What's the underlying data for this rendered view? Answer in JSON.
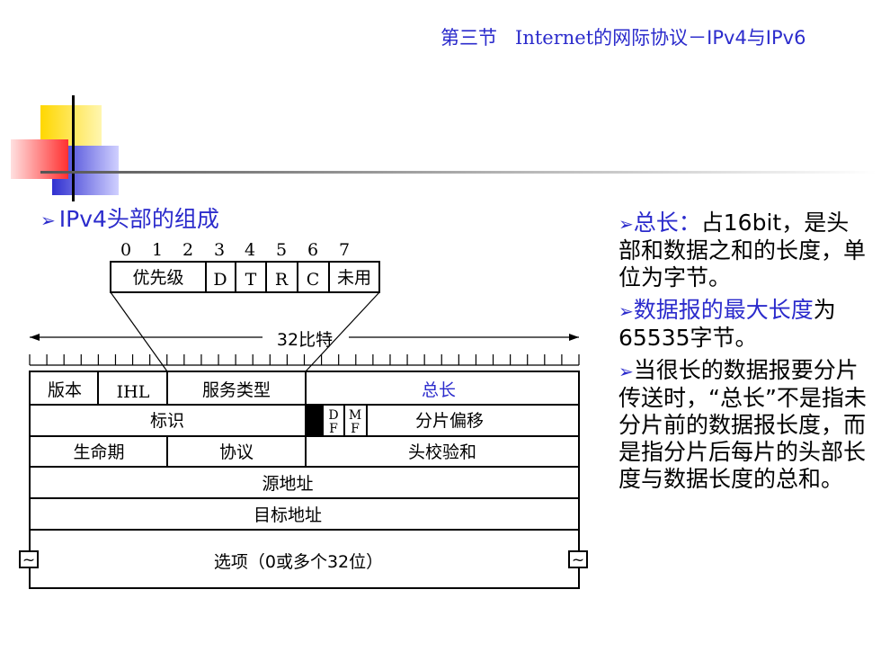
{
  "header": {
    "prefix": "第三节",
    "middle": "Internet",
    "suffix": "的网际协议－IPv4与IPv6"
  },
  "heading": {
    "arrow": "➢",
    "text": "IPv4头部的组成"
  },
  "tos_field": {
    "bit_labels": [
      "0",
      "1",
      "2",
      "3",
      "4",
      "5",
      "6",
      "7"
    ],
    "cells": [
      "优先级",
      "D",
      "T",
      "R",
      "C",
      "未用"
    ]
  },
  "ruler": {
    "label": "32比特"
  },
  "header_table": {
    "row1": {
      "version": "版本",
      "ihl": "IHL",
      "tos": "服务类型",
      "total_length": "总长"
    },
    "row2": {
      "identification": "标识",
      "df": "D F",
      "mf": "M F",
      "fragment_offset": "分片偏移"
    },
    "row3": {
      "ttl": "生命期",
      "protocol": "协议",
      "checksum": "头校验和"
    },
    "row4": {
      "source": "源地址"
    },
    "row5": {
      "destination": "目标地址"
    },
    "row6": {
      "options": "选项（0或多个32位）",
      "tilde": "~"
    }
  },
  "notes": [
    {
      "arrow": "➢",
      "highlight": "总长：",
      "text": "占16bit，是头部和数据之和的长度，单位为字节。"
    },
    {
      "arrow": "➢",
      "highlight": "数据报的最大长度",
      "text": "为65535字节。"
    },
    {
      "arrow": "➢",
      "highlight": "",
      "text": "当很长的数据报要分片传送时，“总长”不是指未分片前的数据报长度，而是指分片后每片的头部长度与数据长度的总和。"
    }
  ],
  "colors": {
    "accent": "#2b2bcc",
    "yellow": "#ffd700",
    "red": "#ff4040",
    "blue": "#3a3ad8"
  }
}
